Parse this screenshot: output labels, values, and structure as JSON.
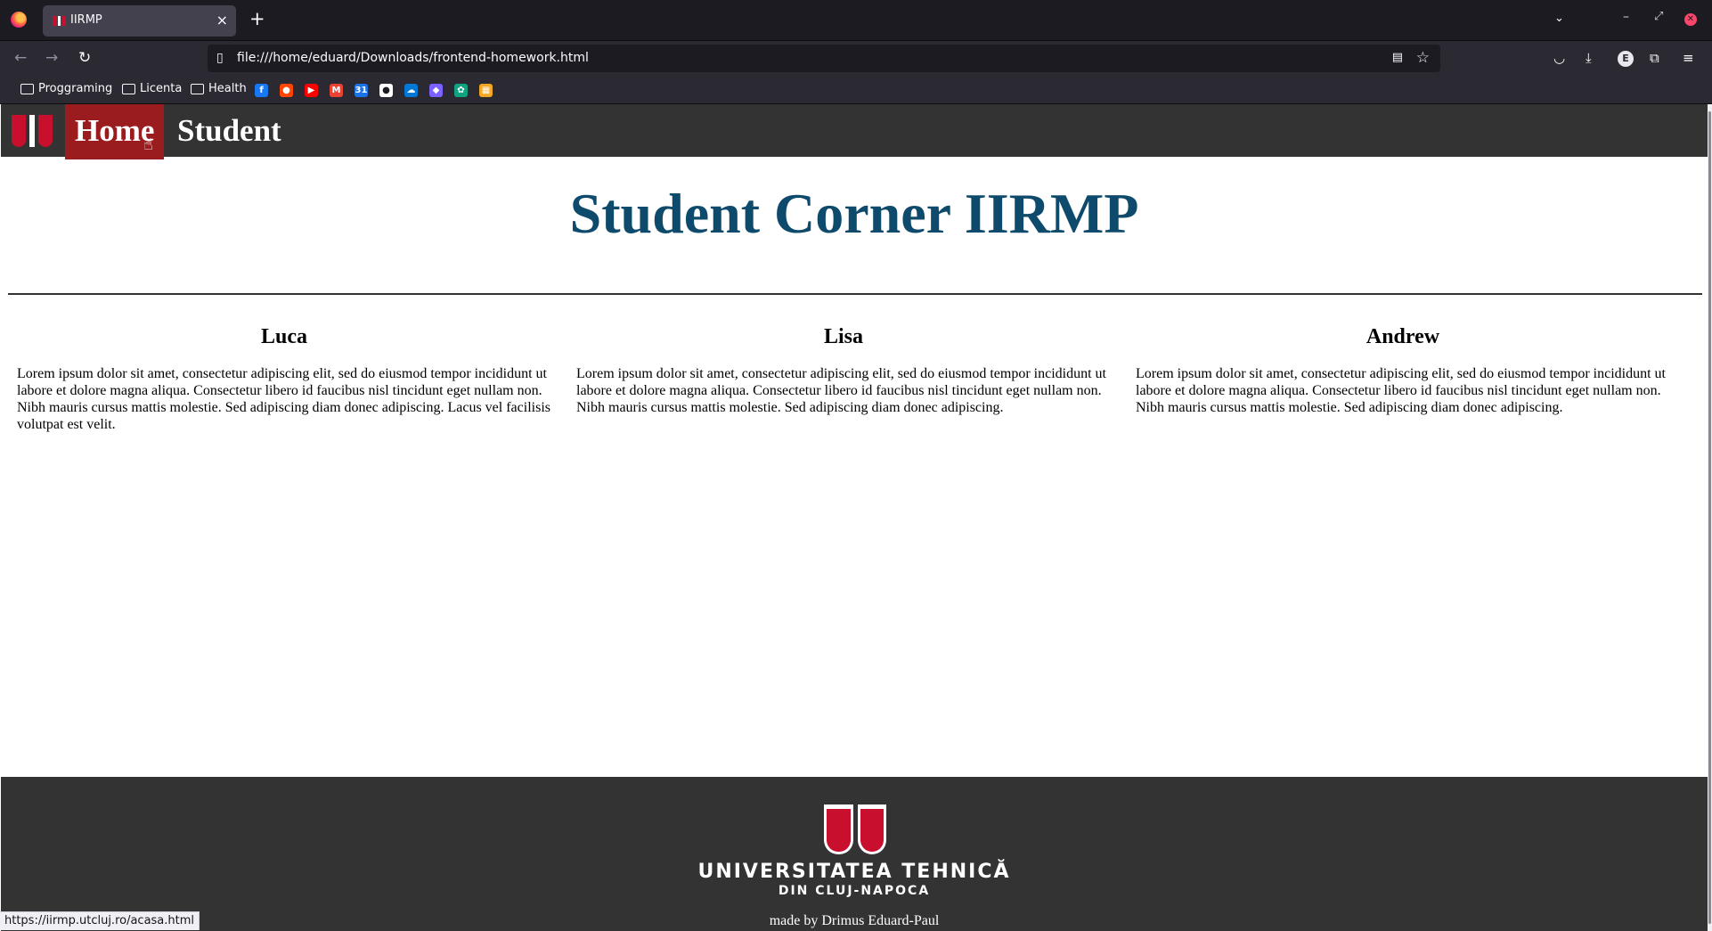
{
  "browser": {
    "tab_title": "IIRMP",
    "url": "file:///home/eduard/Downloads/frontend-homework.html",
    "profile_initial": "E",
    "bookmarks": {
      "folders": [
        "Proggraming",
        "Licenta",
        "Health"
      ],
      "icons": [
        {
          "name": "facebook-icon",
          "color": "#1877f2",
          "glyph": "f"
        },
        {
          "name": "reddit-icon",
          "color": "#ff4500",
          "glyph": "●"
        },
        {
          "name": "youtube-icon",
          "color": "#ff0000",
          "glyph": "▶"
        },
        {
          "name": "gmail-icon",
          "color": "#ea4335",
          "glyph": "M"
        },
        {
          "name": "calendar-icon",
          "color": "#1a73e8",
          "glyph": "31"
        },
        {
          "name": "github-icon",
          "color": "#ffffff",
          "glyph": "●"
        },
        {
          "name": "onedrive-icon",
          "color": "#0078d4",
          "glyph": "☁"
        },
        {
          "name": "app-icon",
          "color": "#7b61ff",
          "glyph": "◆"
        },
        {
          "name": "chatgpt-icon",
          "color": "#10a37f",
          "glyph": "✿"
        },
        {
          "name": "grid-app-icon",
          "color": "#f5a623",
          "glyph": "▦"
        }
      ]
    },
    "status_url": "https://iirmp.utcluj.ro/acasa.html"
  },
  "site": {
    "nav": {
      "home": "Home",
      "student": "Student"
    },
    "title": "Student Corner IIRMP",
    "students": [
      {
        "name": "Luca",
        "text": "Lorem ipsum dolor sit amet, consectetur adipiscing elit, sed do eiusmod tempor incididunt ut labore et dolore magna aliqua. Consectetur libero id faucibus nisl tincidunt eget nullam non. Nibh mauris cursus mattis molestie. Sed adipiscing diam donec adipiscing. Lacus vel facilisis volutpat est velit."
      },
      {
        "name": "Lisa",
        "text": "Lorem ipsum dolor sit amet, consectetur adipiscing elit, sed do eiusmod tempor incididunt ut labore et dolore magna aliqua. Consectetur libero id faucibus nisl tincidunt eget nullam non. Nibh mauris cursus mattis molestie. Sed adipiscing diam donec adipiscing."
      },
      {
        "name": "Andrew",
        "text": "Lorem ipsum dolor sit amet, consectetur adipiscing elit, sed do eiusmod tempor incididunt ut labore et dolore magna aliqua. Consectetur libero id faucibus nisl tincidunt eget nullam non. Nibh mauris cursus mattis molestie. Sed adipiscing diam donec adipiscing."
      }
    ],
    "footer": {
      "university": "UNIVERSITATEA TEHNICĂ",
      "city": "DIN CLUJ-NAPOCA",
      "credit": "made by Drimus Eduard-Paul"
    },
    "colors": {
      "nav_bg": "#333333",
      "active_nav": "#9b1c1f",
      "title": "#0e4a6b",
      "brand_red": "#c8102e"
    }
  }
}
